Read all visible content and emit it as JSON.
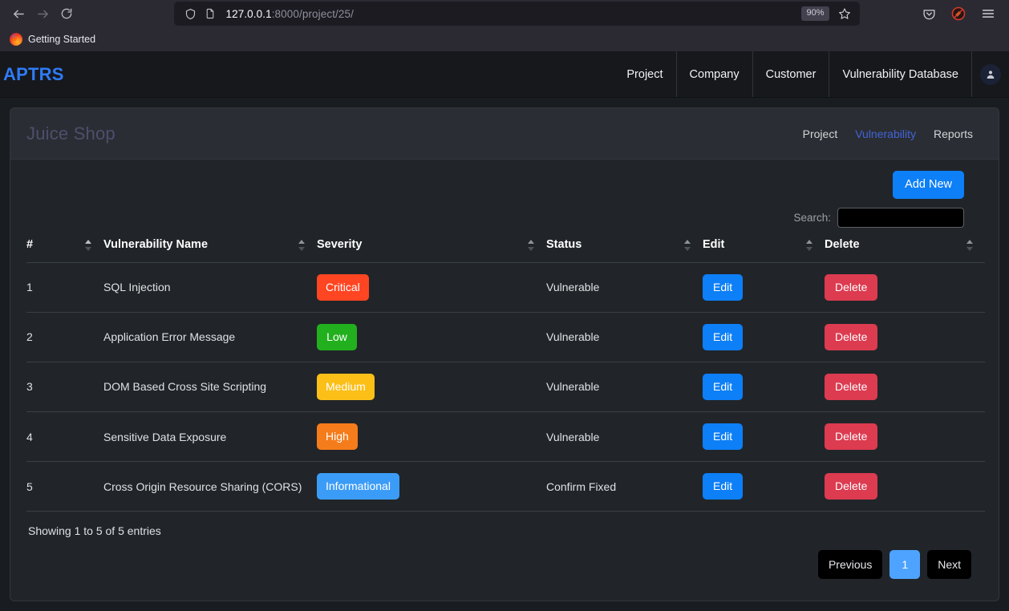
{
  "browser": {
    "back_icon": "arrow-left-icon",
    "forward_icon": "arrow-right-icon",
    "reload_icon": "reload-icon",
    "shield_icon": "shield-icon",
    "page_icon": "page-document-icon",
    "url_host": "127.0.0.1",
    "url_path": ":8000/project/25/",
    "zoom_level": "90%",
    "bookmark_star_icon": "star-icon",
    "pocket_icon": "pocket-icon",
    "extension_icon": "extension-blocked-icon",
    "menu_icon": "hamburger-menu-icon",
    "bookmarks": [
      {
        "label": "Getting Started",
        "icon": "firefox-logo-icon"
      }
    ]
  },
  "app": {
    "brand": "APTRS",
    "nav_links": [
      {
        "label": "Project"
      },
      {
        "label": "Company"
      },
      {
        "label": "Customer"
      },
      {
        "label": "Vulnerability Database"
      }
    ],
    "avatar_icon": "user-avatar-icon"
  },
  "card": {
    "project_title": "Juice Shop",
    "tabs": [
      {
        "label": "Project",
        "active": false
      },
      {
        "label": "Vulnerability",
        "active": true
      },
      {
        "label": "Reports",
        "active": false
      }
    ]
  },
  "toolbar": {
    "add_new_label": "Add New",
    "search_label": "Search:",
    "search_value": "",
    "search_placeholder": ""
  },
  "table": {
    "columns": [
      {
        "label": "#"
      },
      {
        "label": "Vulnerability Name"
      },
      {
        "label": "Severity"
      },
      {
        "label": "Status"
      },
      {
        "label": "Edit"
      },
      {
        "label": "Delete"
      }
    ],
    "edit_label": "Edit",
    "delete_label": "Delete",
    "rows": [
      {
        "num": "1",
        "name": "SQL Injection",
        "severity": "Critical",
        "severity_color": "#ff4522",
        "status": "Vulnerable"
      },
      {
        "num": "2",
        "name": "Application Error Message",
        "severity": "Low",
        "severity_color": "#22b01e",
        "status": "Vulnerable"
      },
      {
        "num": "3",
        "name": "DOM Based Cross Site Scripting",
        "severity": "Medium",
        "severity_color": "#fbbf18",
        "status": "Vulnerable"
      },
      {
        "num": "4",
        "name": "Sensitive Data Exposure",
        "severity": "High",
        "severity_color": "#f57c1b",
        "status": "Vulnerable"
      },
      {
        "num": "5",
        "name": "Cross Origin Resource Sharing (CORS)",
        "severity": "Informational",
        "severity_color": "#3b9cf7",
        "status": "Confirm Fixed"
      }
    ]
  },
  "footer": {
    "entries_info": "Showing 1 to 5 of 5 entries",
    "previous_label": "Previous",
    "current_page": "1",
    "next_label": "Next"
  },
  "colors": {
    "accent_blue": "#0d7ff7",
    "brand_blue": "#2f7bf6",
    "active_tab": "#4263d8",
    "delete_red": "#dc3b50",
    "page_bg": "#191c20",
    "card_bg": "#212529",
    "card_header_bg": "#2a2e34"
  }
}
